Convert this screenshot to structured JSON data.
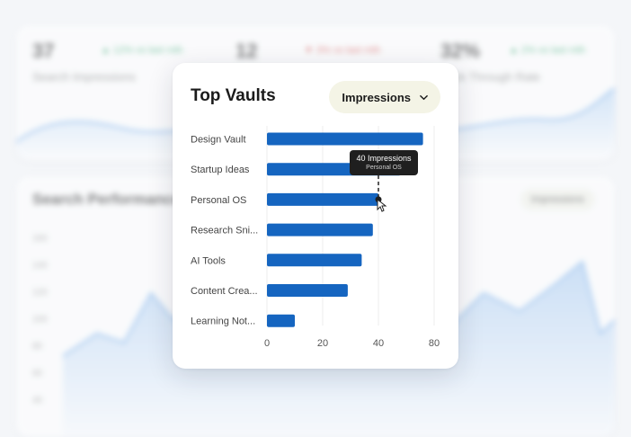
{
  "background": {
    "stats": [
      {
        "value": "37",
        "delta": "12%",
        "delta_dir": "up",
        "delta_text": "vs last mth",
        "caption": "Search Impressions"
      },
      {
        "value": "12",
        "delta": "3%",
        "delta_dir": "down",
        "delta_text": "vs last mth",
        "caption": ""
      },
      {
        "value": "32%",
        "delta": "2%",
        "delta_dir": "up",
        "delta_text": "vs last mth",
        "caption": "Click Through Rate"
      }
    ],
    "performance": {
      "title": "Search Performance",
      "selector": "Impressions",
      "y_labels": [
        "160",
        "140",
        "120",
        "100",
        "80",
        "60",
        "40"
      ]
    }
  },
  "card": {
    "title": "Top Vaults",
    "metric_selector": "Impressions",
    "tooltip": {
      "value_line": "40 Impressions",
      "category_line": "Personal OS"
    }
  },
  "chart_data": {
    "type": "bar",
    "orientation": "horizontal",
    "title": "Top Vaults",
    "categories": [
      "Design Vault",
      "Startup Ideas",
      "Personal OS",
      "Research Sni...",
      "AI Tools",
      "Content Crea...",
      "Learning Not..."
    ],
    "values": [
      56,
      48,
      40,
      38,
      34,
      29,
      10
    ],
    "xlim": [
      0,
      80
    ],
    "x_ticks": [
      "0",
      "20",
      "40",
      "80"
    ],
    "x_tick_values": [
      0,
      20,
      40,
      60
    ],
    "grid": true,
    "highlighted_index": 2,
    "bar_color": "#1565c0"
  },
  "colors": {
    "accent": "#1565c0",
    "selector_bg": "#f4f4e6",
    "tooltip_bg": "#1f1f1f",
    "up": "#2ca56a",
    "down": "#d24545"
  }
}
